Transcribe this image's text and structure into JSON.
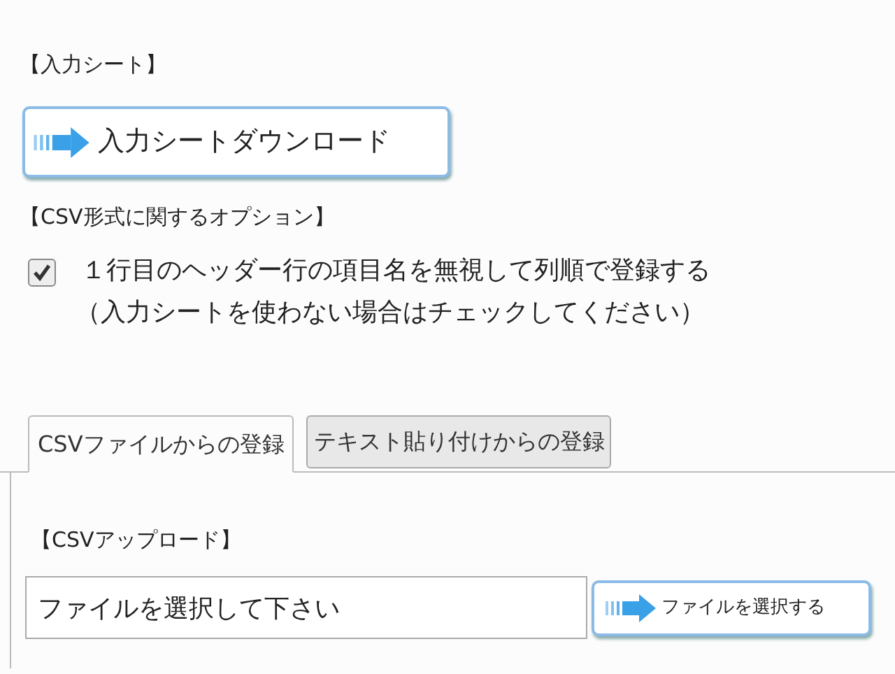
{
  "input_sheet": {
    "heading": "【入力シート】",
    "download_button": "入力シートダウンロード"
  },
  "csv_options": {
    "heading": "【CSV形式に関するオプション】",
    "ignore_header": {
      "label": "１行目のヘッダー行の項目名を無視して列順で登録する",
      "note": "（入力シートを使わない場合はチェックしてください）",
      "checked": true
    }
  },
  "tabs": [
    {
      "label": "CSVファイルからの登録",
      "selected": true
    },
    {
      "label": "テキスト貼り付けからの登録",
      "selected": false
    }
  ],
  "upload": {
    "heading": "【CSVアップロード】",
    "file_field": {
      "value": "ファイルを選択して下さい"
    },
    "select_button": "ファイルを選択する"
  }
}
